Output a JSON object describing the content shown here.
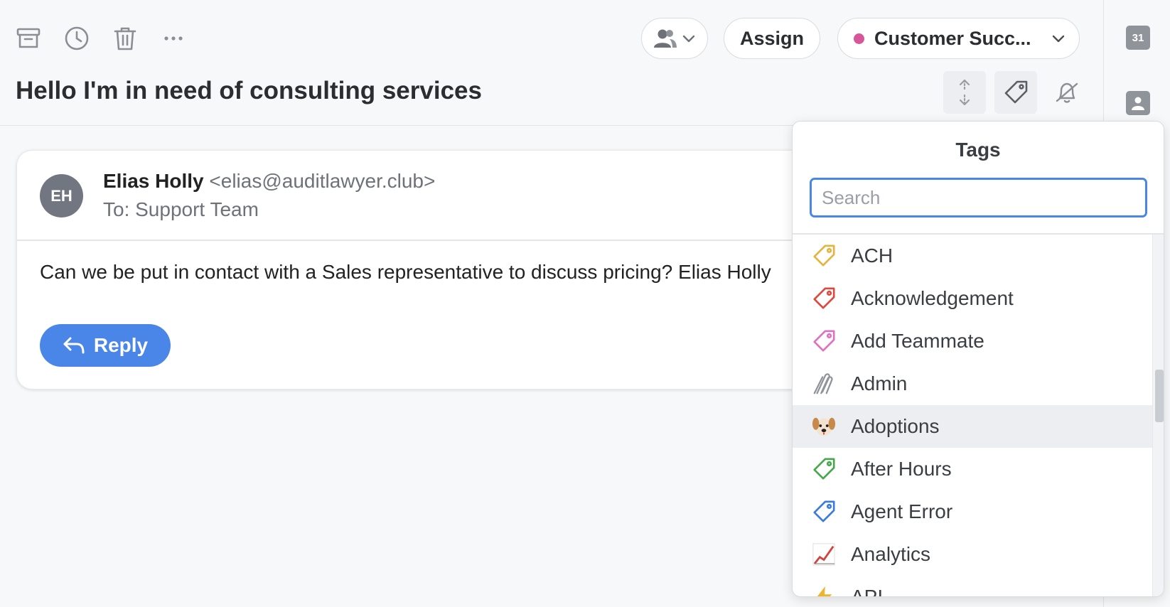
{
  "toolbar": {
    "archive_icon": "archive-icon",
    "snooze_icon": "clock-icon",
    "delete_icon": "trash-icon",
    "more_icon": "more-icon",
    "assign_label": "Assign",
    "team_label": "Customer Succ...",
    "team_color": "#d7569a"
  },
  "subject": "Hello I'm in need of consulting services",
  "message": {
    "avatar_initials": "EH",
    "sender_name": "Elias Holly",
    "sender_email": "<elias@auditlawyer.club>",
    "to_line": "To: Support Team",
    "body": "Can we be put in contact with a Sales representative to discuss pricing? Elias Holly",
    "reply_label": "Reply"
  },
  "tags_dropdown": {
    "title": "Tags",
    "search_placeholder": "Search",
    "items": [
      {
        "label": "ACH",
        "icon": "tag-icon",
        "color": "#e6b43c"
      },
      {
        "label": "Acknowledgement",
        "icon": "tag-icon",
        "color": "#e0483e"
      },
      {
        "label": "Add Teammate",
        "icon": "tag-icon",
        "color": "#e070c0"
      },
      {
        "label": "Admin",
        "icon": "paperclip-icon",
        "color": "#8f939a"
      },
      {
        "label": "Adoptions",
        "icon": "dog-icon",
        "color": "#c88a4a"
      },
      {
        "label": "After Hours",
        "icon": "tag-icon",
        "color": "#46a84a"
      },
      {
        "label": "Agent Error",
        "icon": "tag-icon",
        "color": "#3a7be0"
      },
      {
        "label": "Analytics",
        "icon": "chart-icon",
        "color": "#d0453c"
      },
      {
        "label": "API",
        "icon": "lightning-icon",
        "color": "#f0b429"
      }
    ]
  },
  "right_rail": {
    "calendar_label": "31"
  }
}
